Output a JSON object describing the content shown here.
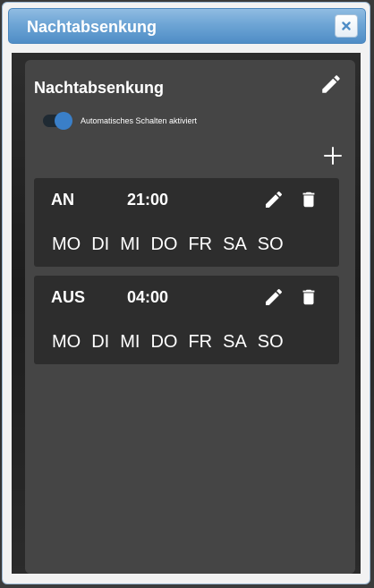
{
  "dialog": {
    "title": "Nachtabsenkung"
  },
  "card": {
    "title": "Nachtabsenkung",
    "toggle": {
      "label": "Automatisches Schalten aktiviert",
      "checked": true,
      "color": "#3a7fc8"
    }
  },
  "schedules": [
    {
      "label": "AN",
      "time": "21:00",
      "days": [
        "MO",
        "DI",
        "MI",
        "DO",
        "FR",
        "SA",
        "SO"
      ]
    },
    {
      "label": "AUS",
      "time": "04:00",
      "days": [
        "MO",
        "DI",
        "MI",
        "DO",
        "FR",
        "SA",
        "SO"
      ]
    }
  ],
  "icons": {
    "close": "close-icon",
    "edit": "pencil-icon",
    "delete": "trash-icon",
    "add": "plus-icon"
  },
  "colors": {
    "titlebar": "#6ea5d5",
    "card": "#454545",
    "schedule": "#2d2d2d",
    "accent": "#3a7fc8"
  }
}
